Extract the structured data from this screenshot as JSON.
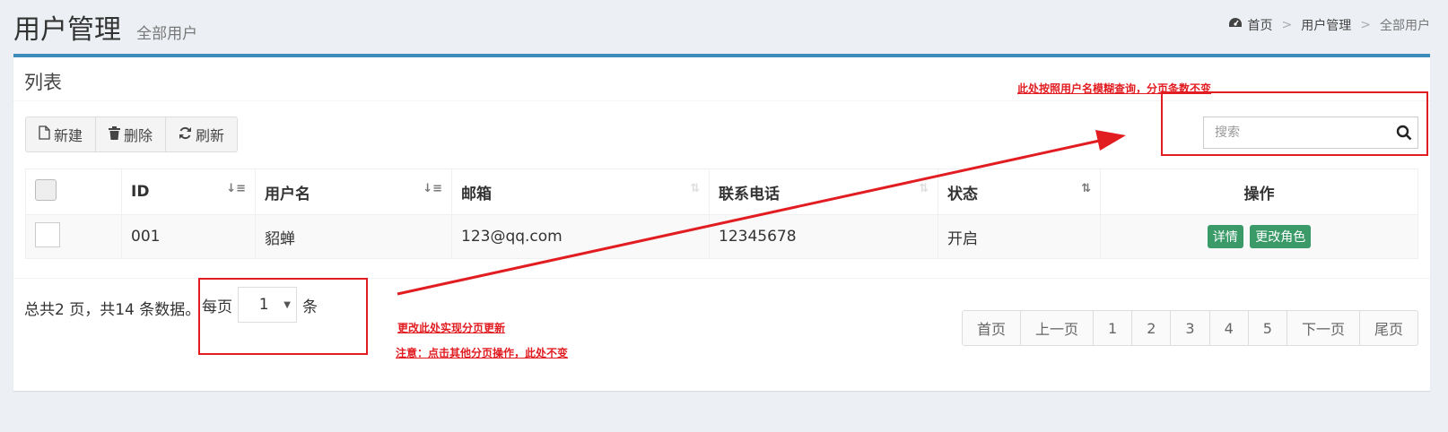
{
  "header": {
    "title": "用户管理",
    "subtitle": "全部用户"
  },
  "breadcrumb": [
    {
      "label": "首页",
      "icon": "dashboard-icon"
    },
    {
      "label": "用户管理"
    },
    {
      "label": "全部用户"
    }
  ],
  "breadcrumb_separator": ">",
  "box": {
    "title": "列表"
  },
  "toolbar": {
    "new_label": "新建",
    "delete_label": "删除",
    "refresh_label": "刷新"
  },
  "search": {
    "placeholder": "搜索",
    "value": ""
  },
  "table": {
    "columns": [
      "ID",
      "用户名",
      "邮箱",
      "联系电话",
      "状态",
      "操作"
    ],
    "rows": [
      {
        "id": "001",
        "username": "貂蝉",
        "email": "123@qq.com",
        "phone": "12345678",
        "status": "开启",
        "actions": [
          "详情",
          "更改角色"
        ]
      }
    ]
  },
  "footer": {
    "total_text": "总共2 页，共14 条数据。",
    "per_page_prefix": "每页",
    "per_page_value": "1",
    "per_page_suffix": "条"
  },
  "pagination": [
    "首页",
    "上一页",
    "1",
    "2",
    "3",
    "4",
    "5",
    "下一页",
    "尾页"
  ],
  "annotations": {
    "search_note": "此处按照用户名模糊查询，分页条数不变",
    "page_size_note": "更改此处实现分页更新",
    "page_size_note2": "注意：点击其他分页操作，此处不变"
  },
  "colors": {
    "accent": "#3c8dbc",
    "annotation": "#e11d22",
    "action_button": "#3a9a68",
    "page_background": "#ecf0f5"
  }
}
